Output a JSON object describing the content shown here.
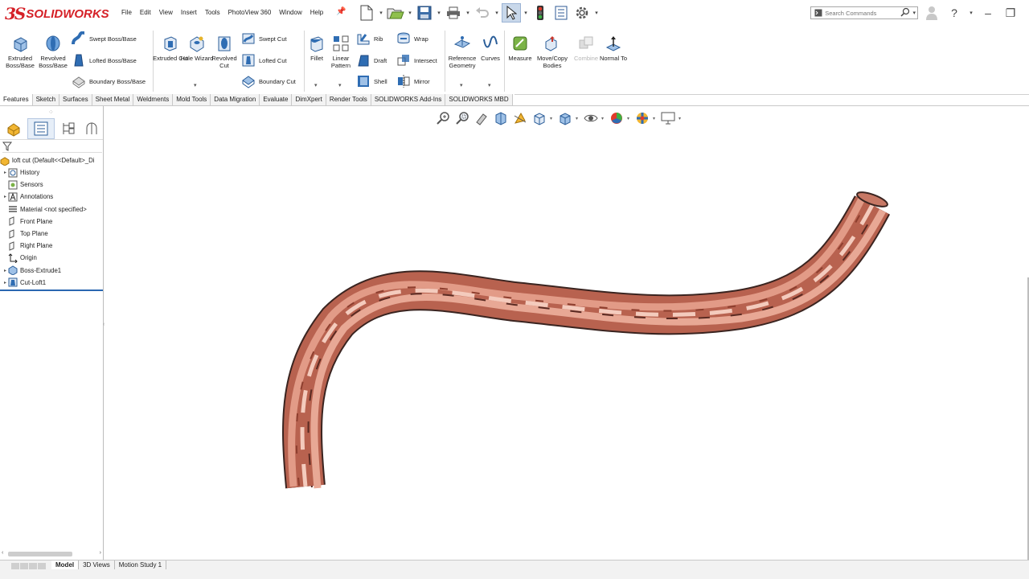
{
  "app": {
    "logo_ds": "3S",
    "logo_name": "SOLIDWORKS"
  },
  "menu": [
    "File",
    "Edit",
    "View",
    "Insert",
    "Tools",
    "PhotoView 360",
    "Window",
    "Help"
  ],
  "search": {
    "placeholder": "Search Commands"
  },
  "ribbon": {
    "extruded_boss": "Extruded Boss/Base",
    "revolved_boss": "Revolved Boss/Base",
    "swept_boss": "Swept Boss/Base",
    "lofted_boss": "Lofted Boss/Base",
    "boundary_boss": "Boundary Boss/Base",
    "extruded_cut": "Extruded Cut",
    "hole_wizard": "Hole Wizard",
    "revolved_cut": "Revolved Cut",
    "swept_cut": "Swept Cut",
    "lofted_cut": "Lofted Cut",
    "boundary_cut": "Boundary Cut",
    "fillet": "Fillet",
    "linear_pattern": "Linear Pattern",
    "rib": "Rib",
    "draft": "Draft",
    "shell": "Shell",
    "wrap": "Wrap",
    "intersect": "Intersect",
    "mirror": "Mirror",
    "reference_geometry": "Reference Geometry",
    "curves": "Curves",
    "measure": "Measure",
    "move_copy": "Move/Copy Bodies",
    "combine": "Combine",
    "normal_to": "Normal To"
  },
  "tabs": [
    "Features",
    "Sketch",
    "Surfaces",
    "Sheet Metal",
    "Weldments",
    "Mold Tools",
    "Data Migration",
    "Evaluate",
    "DimXpert",
    "Render Tools",
    "SOLIDWORKS Add-Ins",
    "SOLIDWORKS MBD"
  ],
  "tree": {
    "root": "loft cut  (Default<<Default>_Di",
    "items": [
      {
        "label": "History",
        "expand": "▸"
      },
      {
        "label": "Sensors",
        "expand": ""
      },
      {
        "label": "Annotations",
        "expand": "▸"
      },
      {
        "label": "Material <not specified>",
        "expand": ""
      },
      {
        "label": "Front Plane",
        "expand": ""
      },
      {
        "label": "Top Plane",
        "expand": ""
      },
      {
        "label": "Right Plane",
        "expand": ""
      },
      {
        "label": "Origin",
        "expand": ""
      },
      {
        "label": "Boss-Extrude1",
        "expand": "▸"
      },
      {
        "label": "Cut-Loft1",
        "expand": "▸"
      }
    ]
  },
  "bottom_tabs": [
    "Model",
    "3D Views",
    "Motion Study 1"
  ],
  "colors": {
    "brand": "#d52027",
    "accent": "#2a67b1",
    "copper": "#c86a55"
  }
}
